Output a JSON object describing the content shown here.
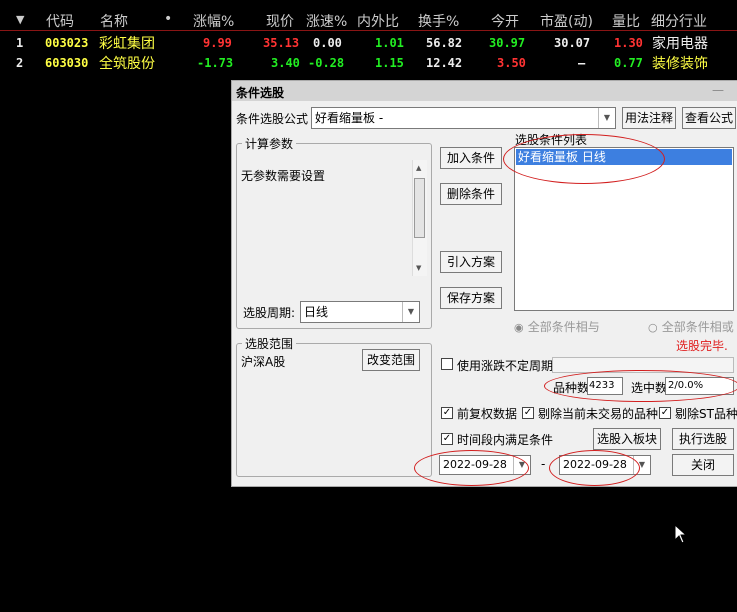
{
  "table": {
    "headers": {
      "sort": "▼",
      "code": "代码",
      "name": "名称",
      "dot": "•",
      "change_pct": "涨幅%",
      "price": "现价",
      "speed": "涨速%",
      "inout": "内外比",
      "turnover": "换手%",
      "open": "今开",
      "pe": "市盈(动)",
      "volratio": "量比",
      "industry": "细分行业"
    },
    "rows": [
      {
        "idx": "1",
        "code": "003023",
        "name": "彩虹集团",
        "change_pct": "9.99",
        "price": "35.13",
        "speed": "0.00",
        "inout": "1.01",
        "turnover": "56.82",
        "open": "30.97",
        "pe": "30.07",
        "volratio": "1.30",
        "industry": "家用电器"
      },
      {
        "idx": "2",
        "code": "603030",
        "name": "全筑股份",
        "change_pct": "-1.73",
        "price": "3.40",
        "speed": "-0.28",
        "inout": "1.15",
        "turnover": "12.42",
        "open": "3.50",
        "pe": "–",
        "volratio": "0.77",
        "industry": "装修装饰"
      }
    ]
  },
  "dialog": {
    "title": "条件选股",
    "min_icon": "—",
    "formula_label": "条件选股公式",
    "formula_value": "好看缩量板   -",
    "usage_btn": "用法注释",
    "view_btn": "查看公式",
    "calc_group": "计算参数",
    "no_params": "无参数需要设置",
    "period_label": "选股周期:",
    "period_value": "日线",
    "range_group": "选股范围",
    "range_value": "沪深A股",
    "change_range_btn": "改变范围",
    "add_btn": "加入条件",
    "del_btn": "删除条件",
    "import_btn": "引入方案",
    "save_btn": "保存方案",
    "list_title": "选股条件列表",
    "list_item": "好看缩量板  日线",
    "radio_and": "全部条件相与",
    "radio_or": "全部条件相或",
    "status": "选股完毕.",
    "use_period_label": "使用涨跌不定周期",
    "count_label": "品种数",
    "count_value": "4233",
    "selected_label": "选中数",
    "selected_value": "2/0.0%",
    "adj_label": "前复权数据",
    "exclude_inactive": "剔除当前未交易的品种",
    "exclude_st": "剔除ST品种",
    "interval_label": "时间段内满足条件",
    "to_block_btn": "选股入板块",
    "run_btn": "执行选股",
    "close_btn": "关闭",
    "date_from": "2022-09-28",
    "date_to": "2022-09-28",
    "date_sep": "-"
  }
}
